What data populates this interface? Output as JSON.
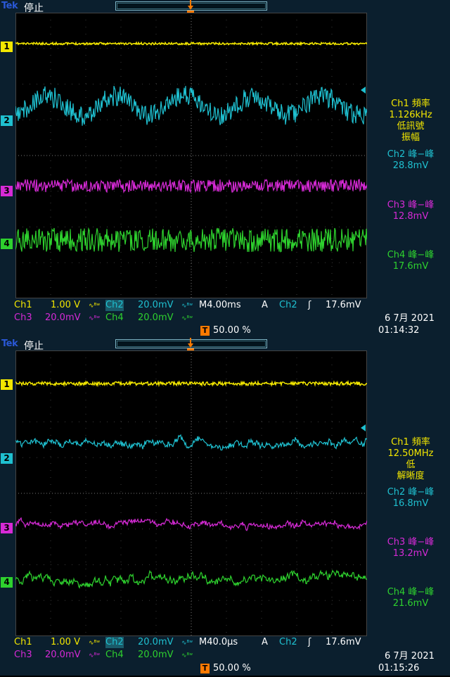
{
  "colors": {
    "ch1": "#f2e600",
    "ch2": "#1fc0d0",
    "ch3": "#d62ad6",
    "ch4": "#2ed12e",
    "trigger": "#ff7a00"
  },
  "screens": [
    {
      "brand": "Tek",
      "state": "停止",
      "channel_markers": [
        "1",
        "2",
        "3",
        "4"
      ],
      "measurements": [
        {
          "lines": [
            "Ch1 頻率",
            "1.126kHz",
            "低訊號",
            "振幅"
          ]
        },
        {
          "lines": [
            "Ch2 峰−峰",
            "28.8mV"
          ]
        },
        {
          "lines": [
            "Ch3 峰−峰",
            "12.8mV"
          ]
        },
        {
          "lines": [
            "Ch4 峰−峰",
            "17.6mV"
          ]
        }
      ],
      "status": {
        "ch1_label": "Ch1",
        "ch1_scale": "1.00 V",
        "ch2_label": "Ch2",
        "ch2_scale": "20.0mV",
        "ch3_label": "Ch3",
        "ch3_scale": "20.0mV",
        "ch4_label": "Ch4",
        "ch4_scale": "20.0mV",
        "coupling": "∿ᴮʷ",
        "timebase": "M4.00ms",
        "acq": "A",
        "trig_source": "Ch2",
        "trig_slope": "ʃ",
        "trig_level": "17.6mV",
        "trig_position": "50.00 %",
        "date": "6 7月  2021",
        "time": "01:14:32"
      }
    },
    {
      "brand": "Tek",
      "state": "停止",
      "channel_markers": [
        "1",
        "2",
        "3",
        "4"
      ],
      "measurements": [
        {
          "lines": [
            "Ch1 頻率",
            "12.50MHz",
            "低",
            "解晰度"
          ]
        },
        {
          "lines": [
            "Ch2 峰−峰",
            "16.8mV"
          ]
        },
        {
          "lines": [
            "Ch3 峰−峰",
            "13.2mV"
          ]
        },
        {
          "lines": [
            "Ch4 峰−峰",
            "21.6mV"
          ]
        }
      ],
      "status": {
        "ch1_label": "Ch1",
        "ch1_scale": "1.00 V",
        "ch2_label": "Ch2",
        "ch2_scale": "20.0mV",
        "ch3_label": "Ch3",
        "ch3_scale": "20.0mV",
        "ch4_label": "Ch4",
        "ch4_scale": "20.0mV",
        "coupling": "∿ᴮʷ",
        "timebase": "M40.0µs",
        "acq": "A",
        "trig_source": "Ch2",
        "trig_slope": "ʃ",
        "trig_level": "17.6mV",
        "trig_position": "50.00 %",
        "date": "6 7月  2021",
        "time": "01:15:26"
      }
    }
  ]
}
